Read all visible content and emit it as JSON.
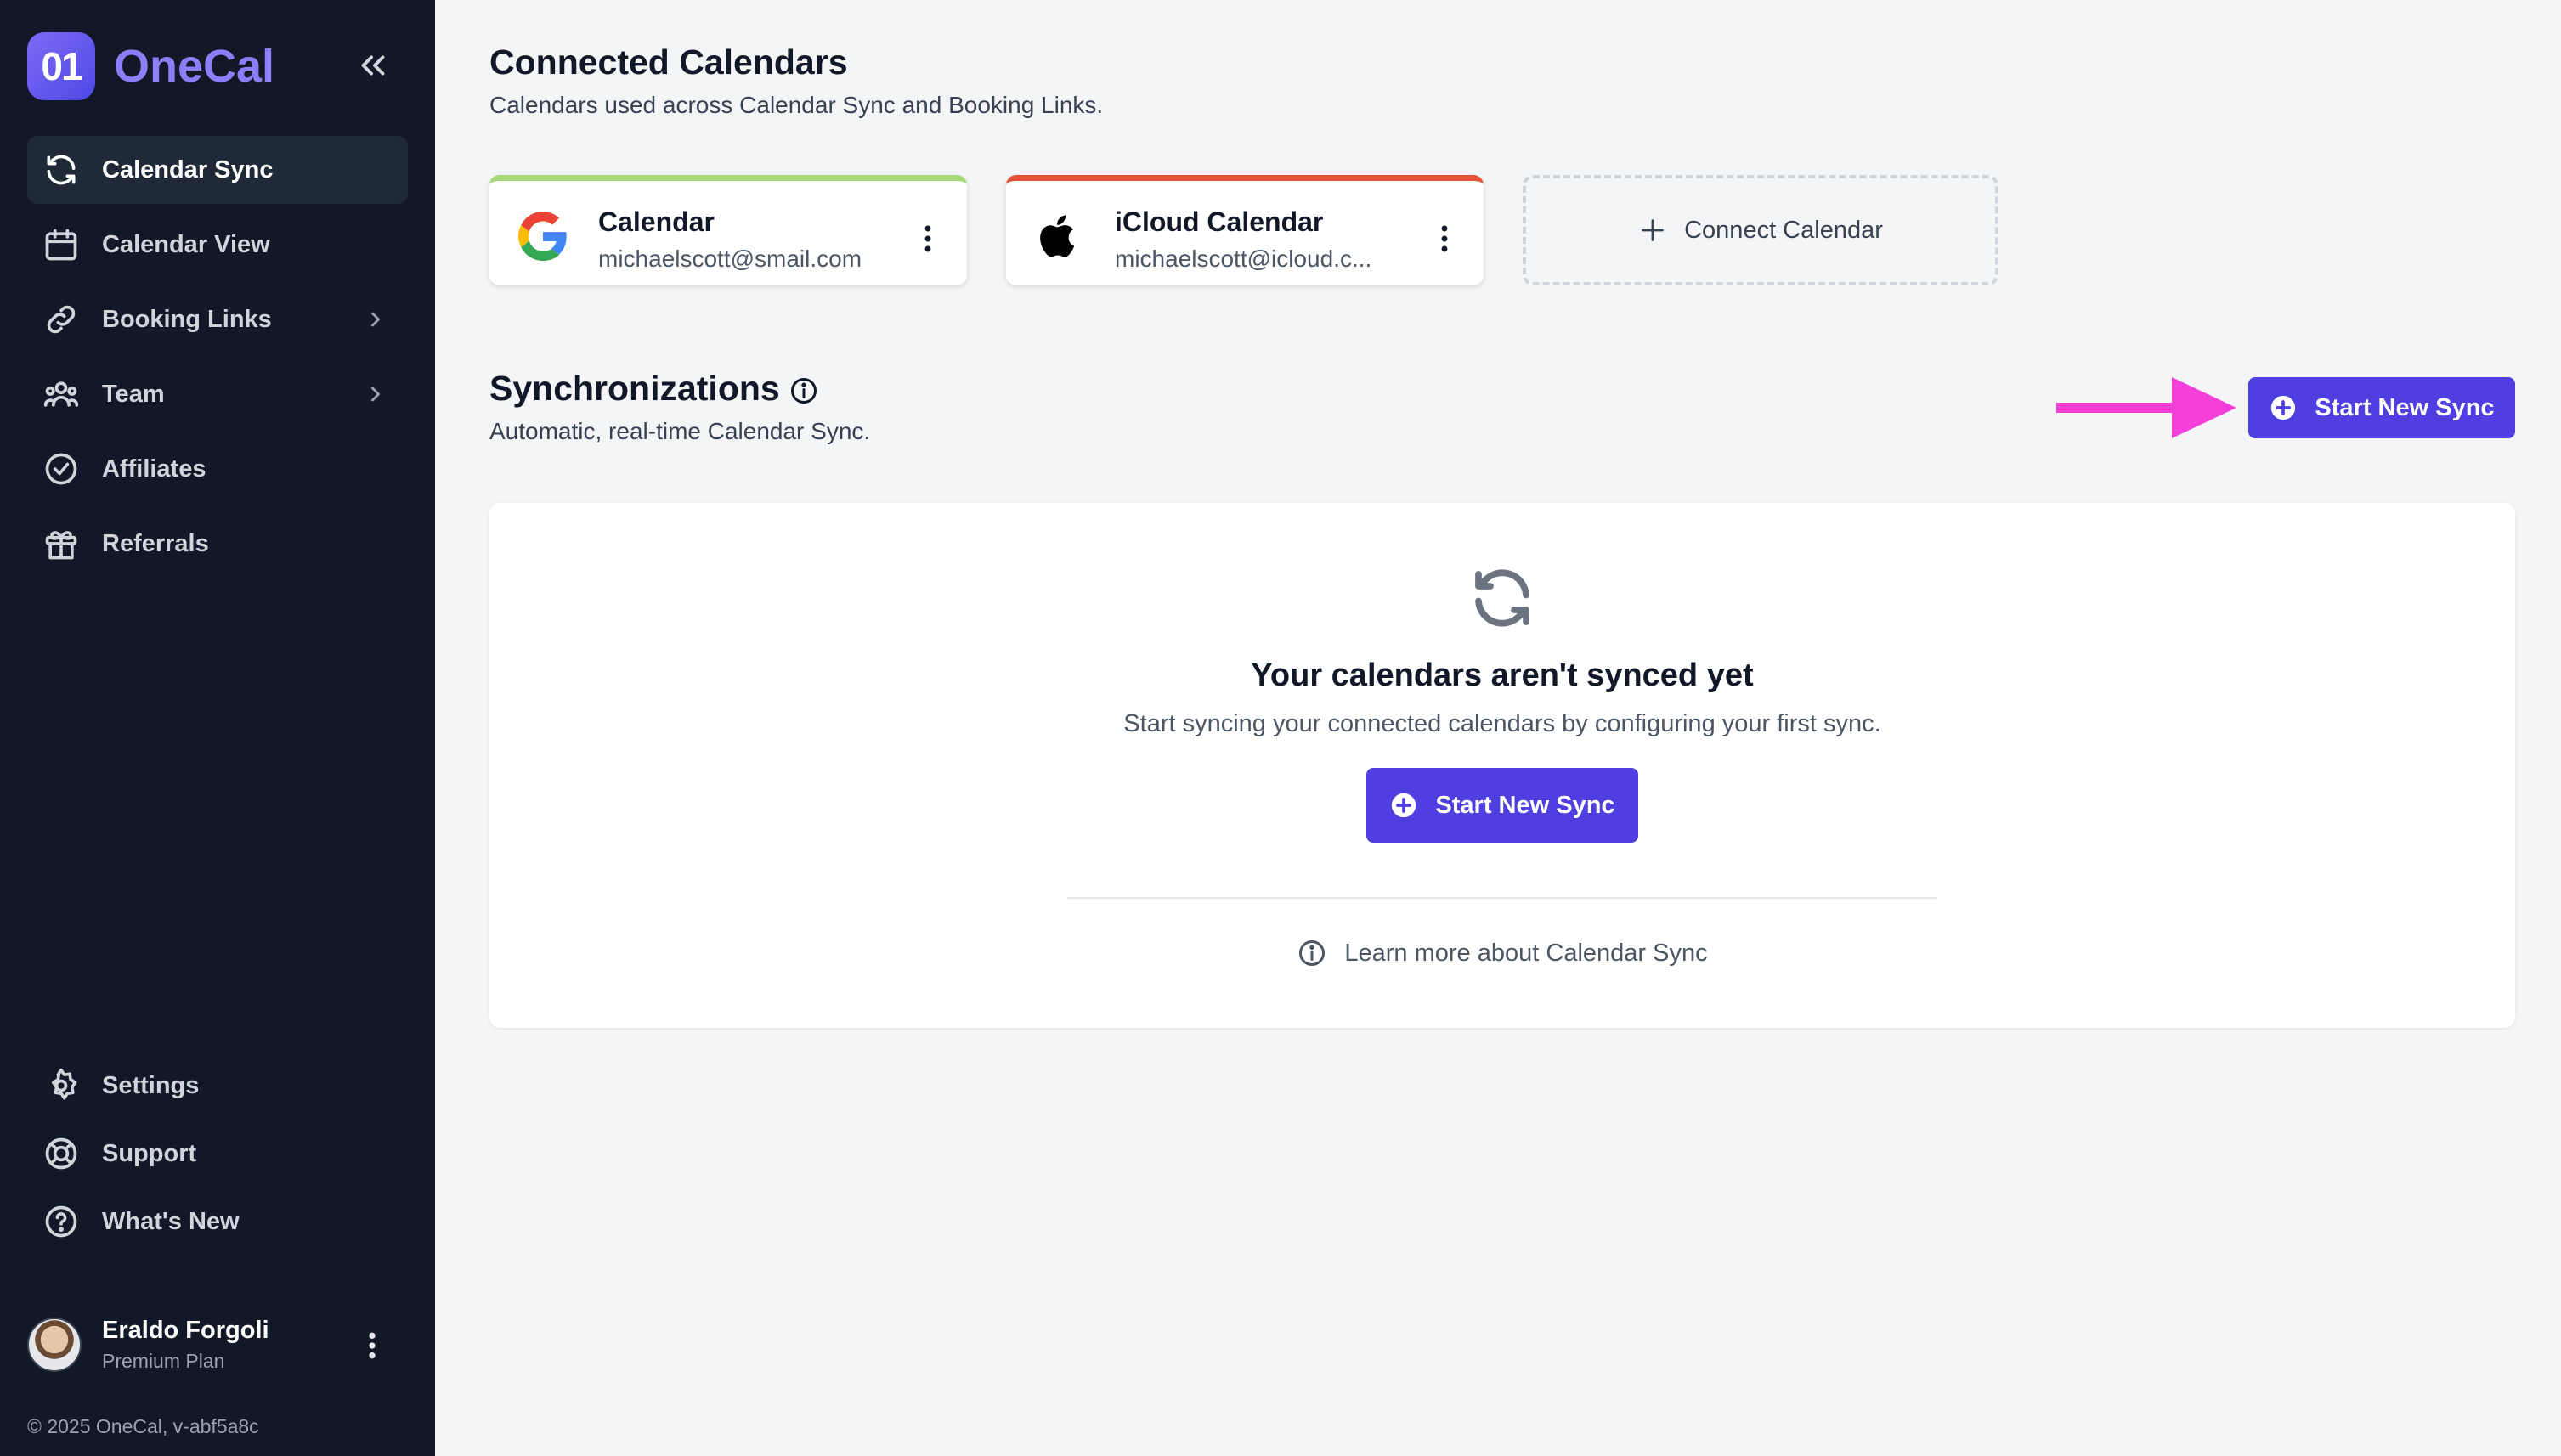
{
  "sidebar": {
    "brand_mark": "01",
    "brand_name": "OneCal",
    "nav": [
      {
        "label": "Calendar Sync",
        "icon": "sync-icon",
        "active": true
      },
      {
        "label": "Calendar View",
        "icon": "calendar-icon"
      },
      {
        "label": "Booking Links",
        "icon": "link-icon",
        "has_children": true
      },
      {
        "label": "Team",
        "icon": "team-icon",
        "has_children": true
      },
      {
        "label": "Affiliates",
        "icon": "check-circle-icon"
      },
      {
        "label": "Referrals",
        "icon": "gift-icon"
      }
    ],
    "bottom_nav": [
      {
        "label": "Settings",
        "icon": "gear-icon"
      },
      {
        "label": "Support",
        "icon": "lifebuoy-icon"
      },
      {
        "label": "What's New",
        "icon": "question-icon"
      }
    ],
    "user": {
      "name": "Eraldo Forgoli",
      "plan": "Premium Plan"
    },
    "copyright": "© 2025 OneCal, v-abf5a8c"
  },
  "connected": {
    "title": "Connected Calendars",
    "subtitle": "Calendars used across Calendar Sync and Booking Links.",
    "calendars": [
      {
        "name": "Calendar",
        "email": "michaelscott@smail.com",
        "provider": "google-logo",
        "accent": "#a3d977"
      },
      {
        "name": "iCloud Calendar",
        "email": "michaelscott@icloud.c...",
        "provider": "apple-logo",
        "accent": "#e0553a"
      }
    ],
    "connect_label": "Connect Calendar"
  },
  "sync": {
    "title": "Synchronizations",
    "subtitle": "Automatic, real-time Calendar Sync.",
    "start_label": "Start New Sync",
    "empty_title": "Your calendars aren't synced yet",
    "empty_subtitle": "Start syncing your connected calendars by configuring your first sync.",
    "empty_button": "Start New Sync",
    "learn_more": "Learn more about Calendar Sync"
  },
  "colors": {
    "primary": "#4f3fe0",
    "sidebar_bg": "#111827",
    "annotation_arrow": "#f43fd8"
  }
}
